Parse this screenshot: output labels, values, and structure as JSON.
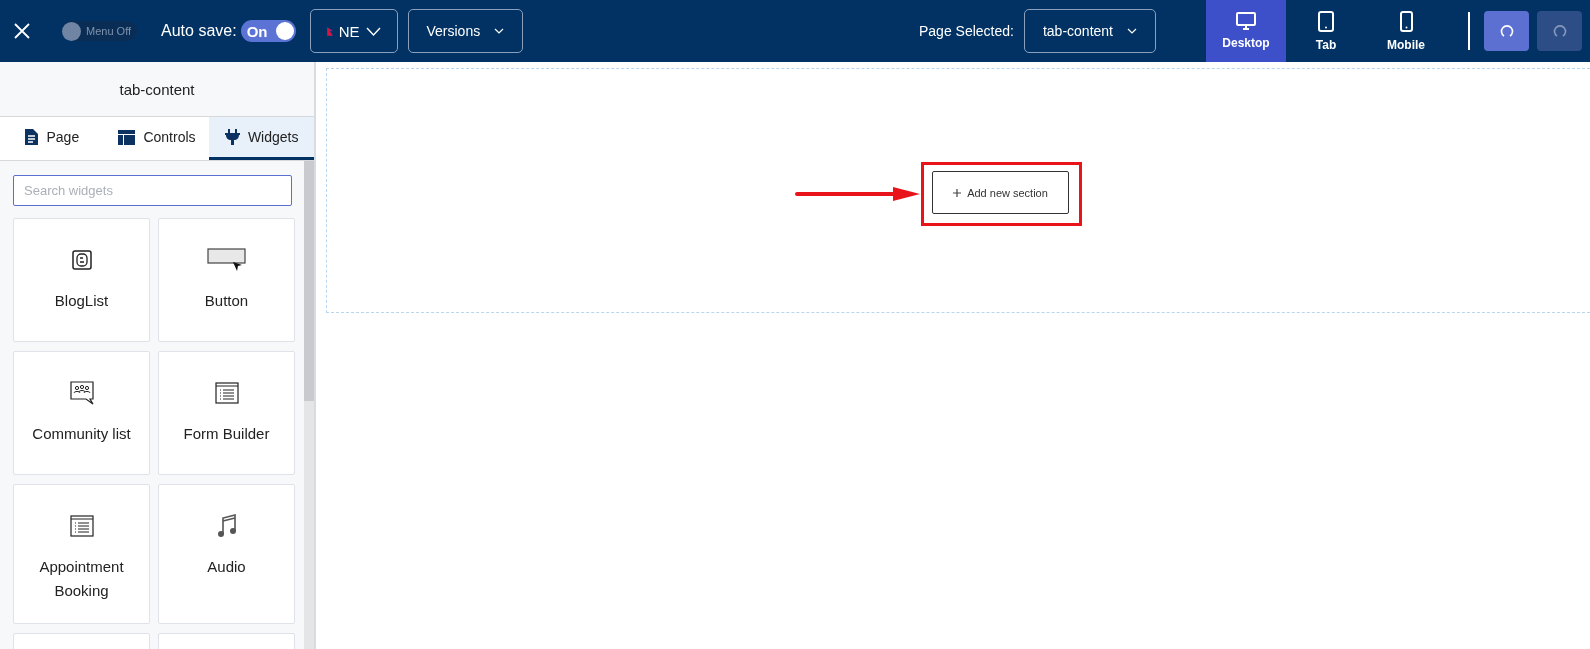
{
  "header": {
    "menu_toggle": {
      "label": "Menu Off",
      "on": false
    },
    "autosave": {
      "label": "Auto save:",
      "on": true,
      "state_text": "On"
    },
    "language": {
      "code": "NE"
    },
    "versions": {
      "label": "Versions"
    },
    "page_selected": {
      "label": "Page Selected:",
      "value": "tab-content"
    },
    "devices": [
      {
        "label": "Desktop",
        "kind": "desktop",
        "selected": true
      },
      {
        "label": "Tab",
        "kind": "tablet",
        "selected": false
      },
      {
        "label": "Mobile",
        "kind": "mobile",
        "selected": false
      }
    ],
    "undo": {
      "disabled": false
    },
    "redo": {
      "disabled": true
    }
  },
  "sidebar": {
    "title": "tab-content",
    "tabs": [
      {
        "label": "Page",
        "kind": "page",
        "selected": false
      },
      {
        "label": "Controls",
        "kind": "controls",
        "selected": false
      },
      {
        "label": "Widgets",
        "kind": "widgets",
        "selected": true
      }
    ],
    "search": {
      "placeholder": "Search widgets"
    },
    "widgets": [
      {
        "label": "BlogList",
        "kind": "blog"
      },
      {
        "label": "Button",
        "kind": "button"
      },
      {
        "label": "Community list",
        "kind": "community"
      },
      {
        "label": "Form Builder",
        "kind": "form"
      },
      {
        "label": "Appointment Booking",
        "kind": "form"
      },
      {
        "label": "Audio",
        "kind": "audio"
      }
    ]
  },
  "canvas": {
    "add_section": {
      "label": "Add new section"
    }
  }
}
